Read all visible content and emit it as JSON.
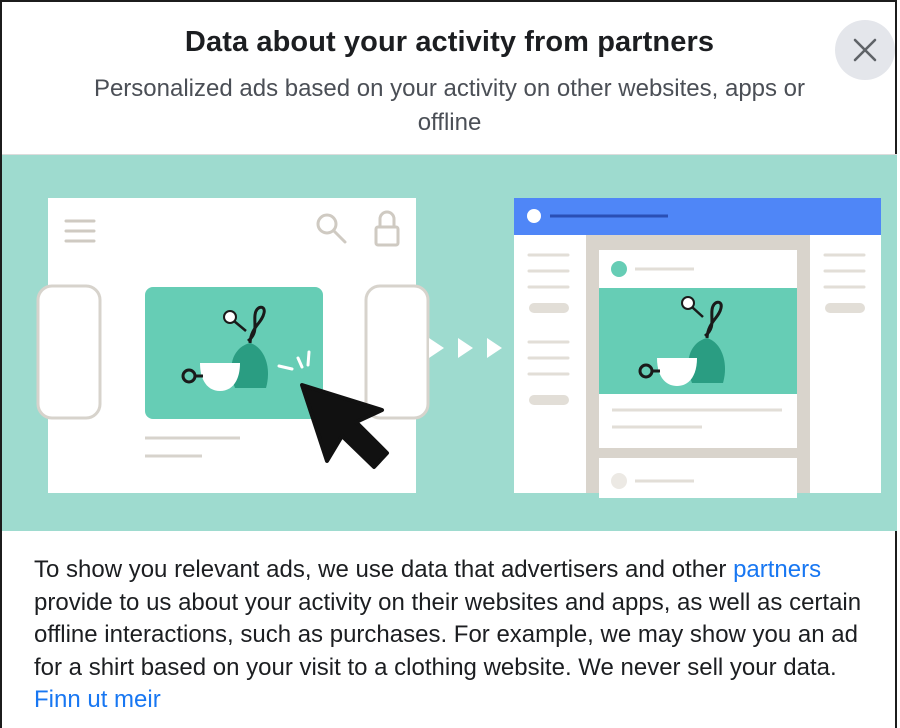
{
  "dialog": {
    "title": "Data about your activity from partners",
    "subtitle": "Personalized ads based on your activity on other websites, apps or offline",
    "close_icon": "close-icon"
  },
  "body": {
    "text_1": "To show you relevant ads, we use data that advertisers and other ",
    "partners_link": "partners",
    "text_2": " provide to us about your activity on their websites and apps, as well as certain offline interactions, such as purchases. For example, we may show you an ad for a shirt based on your visit to a clothing website. We never sell your data. ",
    "learn_more_link": "Finn ut meir"
  },
  "colors": {
    "banner_bg": "#9edbcf",
    "ad_green": "#66cdb5",
    "dark_green": "#2a9d82",
    "feed_blue": "#4f86f7",
    "link_blue": "#1877f2"
  }
}
